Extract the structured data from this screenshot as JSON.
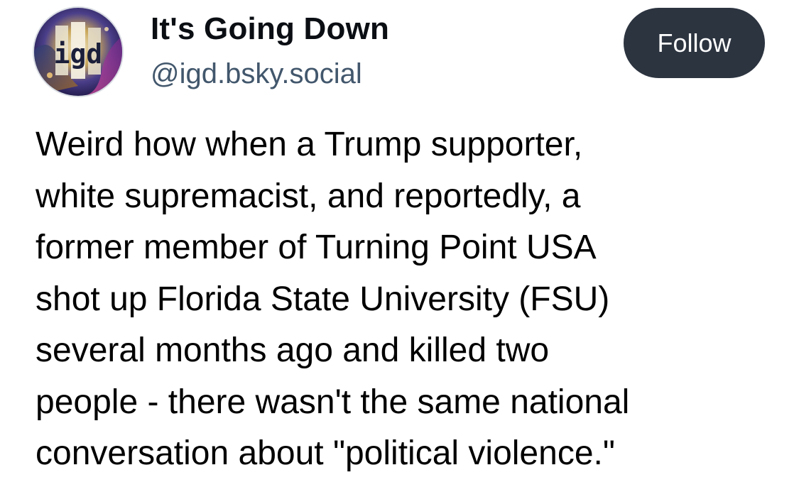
{
  "author": {
    "display_name": "It's Going Down",
    "handle": "@igd.bsky.social",
    "avatar_text": "igd",
    "avatar_icon": "igd-logo-avatar"
  },
  "actions": {
    "follow_label": "Follow"
  },
  "post": {
    "lines": [
      "Weird how when a Trump supporter,",
      "white supremacist, and reportedly, a",
      "former member of Turning Point USA",
      "shot up Florida State University (FSU)",
      "several months ago and killed two",
      "people - there wasn't the same national",
      "conversation about \"political violence.\""
    ]
  },
  "colors": {
    "follow_button_bg": "#2c3440",
    "handle_text": "#42576c"
  }
}
